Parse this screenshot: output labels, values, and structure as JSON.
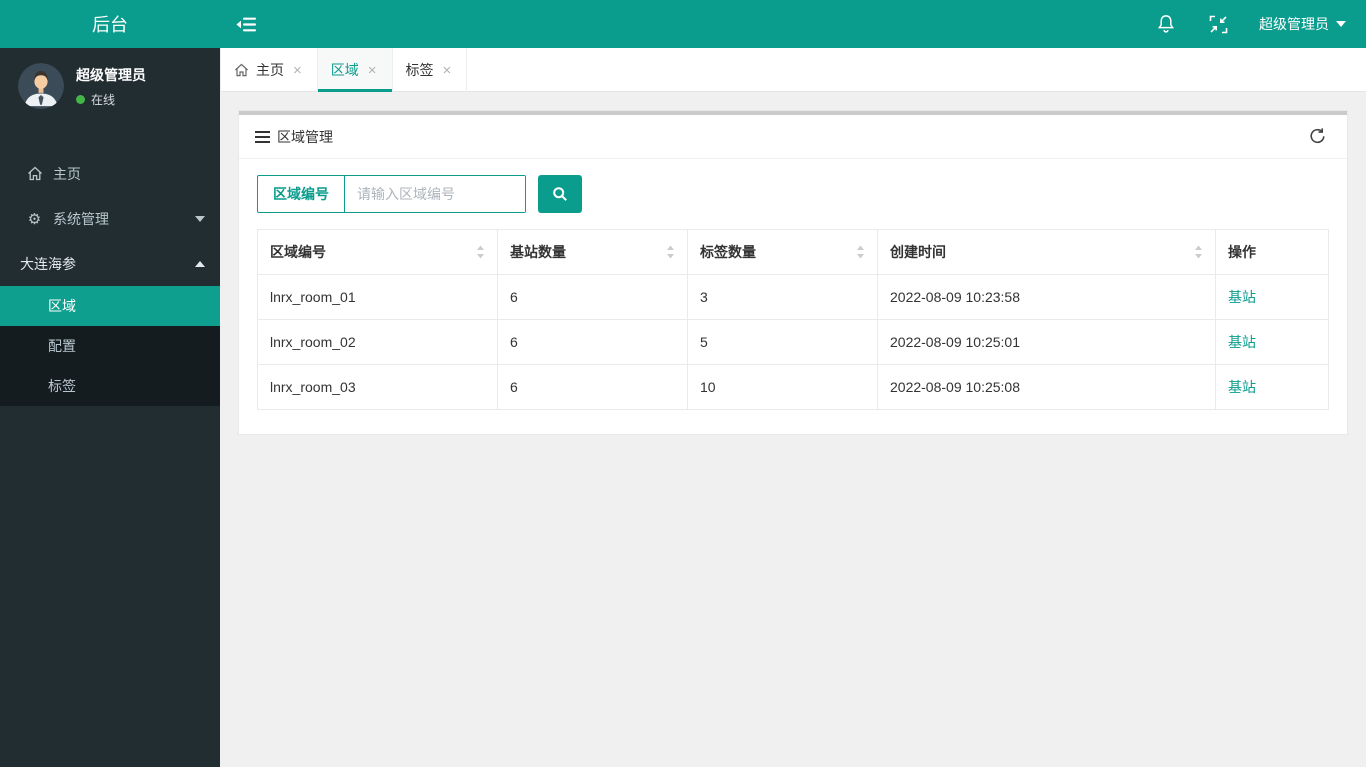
{
  "colors": {
    "accent_teal": "#0a9d8e",
    "sidebar_bg": "#222d32",
    "submenu_bg": "#151c20",
    "online_green": "#44b549",
    "content_bg": "#f0f0f0"
  },
  "brand": "后台",
  "topbar": {
    "user_menu_label": "超级管理员",
    "icons": [
      "menu-fold-icon",
      "bell-icon",
      "compress-icon",
      "caret-down-icon"
    ]
  },
  "sidebar": {
    "user": {
      "name": "超级管理员",
      "status": "在线"
    },
    "menu": {
      "home": "主页",
      "system": "系统管理",
      "dalian": "大连海参",
      "sub_region": "区域",
      "sub_config": "配置",
      "sub_tag": "标签"
    }
  },
  "tabs": {
    "home": "主页",
    "region": "区域",
    "tag": "标签",
    "close_glyph": "×"
  },
  "panel": {
    "title": "区域管理",
    "search": {
      "label": "区域编号",
      "placeholder": "请输入区域编号"
    },
    "table": {
      "headers": [
        "区域编号",
        "基站数量",
        "标签数量",
        "创建时间",
        "操作"
      ],
      "rows": [
        {
          "id": "lnrx_room_01",
          "stations": "6",
          "tags": "3",
          "created": "2022-08-09 10:23:58",
          "action": "基站"
        },
        {
          "id": "lnrx_room_02",
          "stations": "6",
          "tags": "5",
          "created": "2022-08-09 10:25:01",
          "action": "基站"
        },
        {
          "id": "lnrx_room_03",
          "stations": "6",
          "tags": "10",
          "created": "2022-08-09 10:25:08",
          "action": "基站"
        }
      ]
    }
  }
}
